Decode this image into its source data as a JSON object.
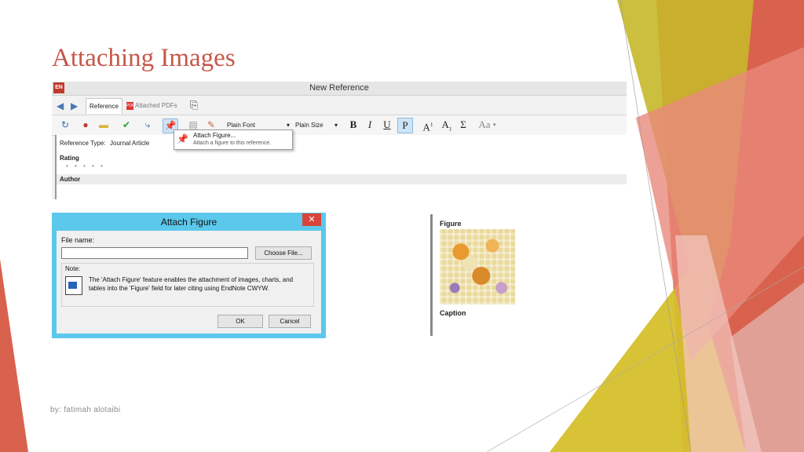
{
  "slide": {
    "title": "Attaching Images",
    "footer": "by: fatimah alotaibi",
    "accent_colors": [
      "#d9624e",
      "#c7b82a",
      "#e9968c",
      "#f3c9c2"
    ]
  },
  "endnote": {
    "logo": "EN",
    "window_title": "New Reference",
    "nav": {
      "back_icon": "arrow-left-icon",
      "forward_icon": "arrow-right-icon"
    },
    "tabs": [
      {
        "label": "Reference",
        "active": true
      },
      {
        "label": "Attached PDFs",
        "active": false
      }
    ],
    "toolbar": {
      "font_value": "Plain Font",
      "size_value": "Plain Size",
      "bold": "B",
      "italic": "I",
      "underline": "U",
      "plain": "P",
      "superscript": "A",
      "superscript_mark": "1",
      "subscript": "A",
      "subscript_mark": "1",
      "symbol": "Σ",
      "case": "Aa"
    },
    "tooltip": {
      "title": "Attach Figure...",
      "description": "Attach a figure to this reference."
    },
    "reference_type_label": "Reference Type:",
    "reference_type_value": "Journal Article",
    "rating_label": "Rating",
    "rating_dots": "• • • • •",
    "author_label": "Author"
  },
  "dialog": {
    "title": "Attach Figure",
    "close": "✕",
    "file_name_label": "File name:",
    "file_name_value": "",
    "choose_file": "Choose File...",
    "note_label": "Note:",
    "note_text": "The 'Attach Figure' feature enables the attachment of images, charts, and tables into the 'Figure' field for later citing using EndNote CWYW.",
    "ok": "OK",
    "cancel": "Cancel"
  },
  "figure_panel": {
    "figure_label": "Figure",
    "caption_label": "Caption"
  }
}
